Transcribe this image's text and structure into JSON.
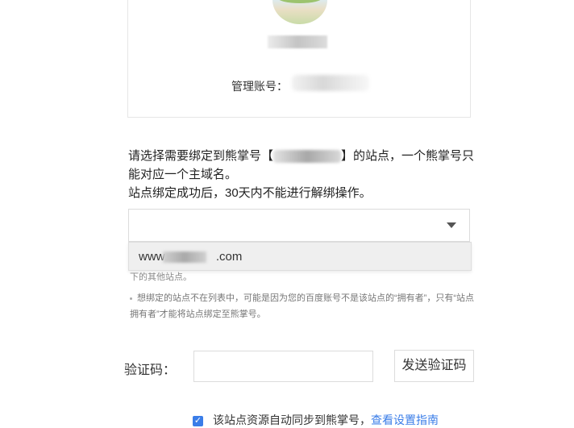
{
  "account": {
    "label": "管理账号："
  },
  "instructions": {
    "line1_prefix": "请选择需要绑定到熊掌号【",
    "line1_suffix": "】的站点，一个熊掌号只能对应一个主域名。",
    "line2": "站点绑定成功后，30天内不能进行解绑操作。"
  },
  "site_select": {
    "option_prefix": "www.",
    "option_suffix": ".com"
  },
  "hints": {
    "partial": "下的其他站点。",
    "not_listed": "想绑定的站点不在列表中，可能是因为您的百度账号不是该站点的“拥有者”，只有“站点拥有者”才能将站点绑定至熊掌号。"
  },
  "verify": {
    "label": "验证码：",
    "input_placeholder": "",
    "send_button": "发送验证码"
  },
  "sync": {
    "checkbox_text": "该站点资源自动同步到熊掌号，",
    "link_text": "查看设置指南",
    "checked": true
  },
  "colors": {
    "accent": "#3a7de8",
    "border": "#dcdcdc"
  }
}
